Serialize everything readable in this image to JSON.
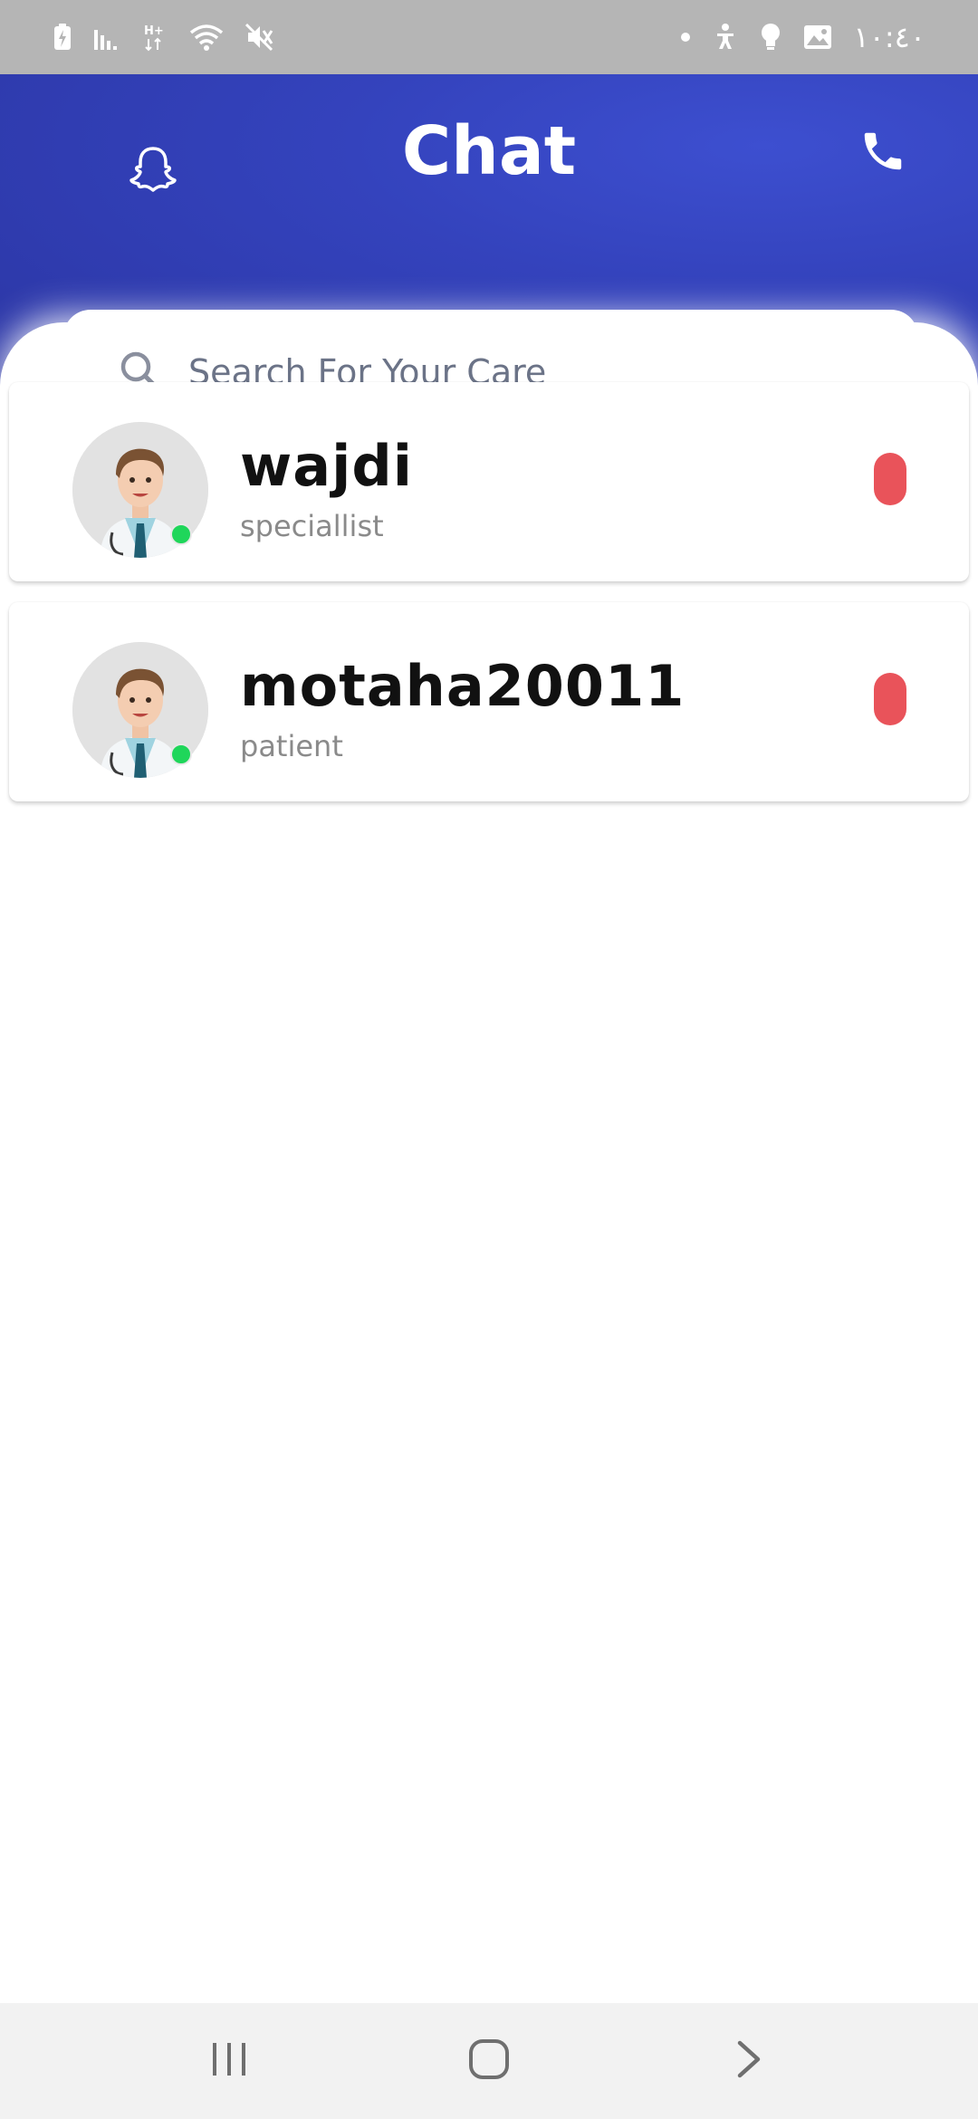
{
  "status_bar": {
    "time": "١٠:٤٠",
    "left_icons": [
      "battery-charging-icon",
      "signal-icon",
      "hplus-icon",
      "wifi-icon",
      "mute-icon"
    ],
    "right_icons": [
      "dot-icon",
      "accessibility-icon",
      "bulb-icon",
      "gallery-icon"
    ]
  },
  "header": {
    "title": "Chat",
    "left_icon": "snapchat-ghost-icon",
    "right_icon": "phone-icon"
  },
  "search": {
    "placeholder": "Search For Your Care",
    "value": "",
    "icon": "search-icon"
  },
  "chats": [
    {
      "name": "wajdi",
      "role": "speciallist",
      "online": true,
      "status_color": "#e9535a"
    },
    {
      "name": "motaha20011",
      "role": "patient",
      "online": true,
      "status_color": "#e9535a"
    }
  ],
  "nav_bar": {
    "items": [
      "recent-apps-icon",
      "home-icon",
      "back-icon"
    ]
  },
  "colors": {
    "header": "#3443bd",
    "online": "#1fd65a",
    "status_pill": "#e9535a",
    "status_bar": "#b5b5b5"
  }
}
